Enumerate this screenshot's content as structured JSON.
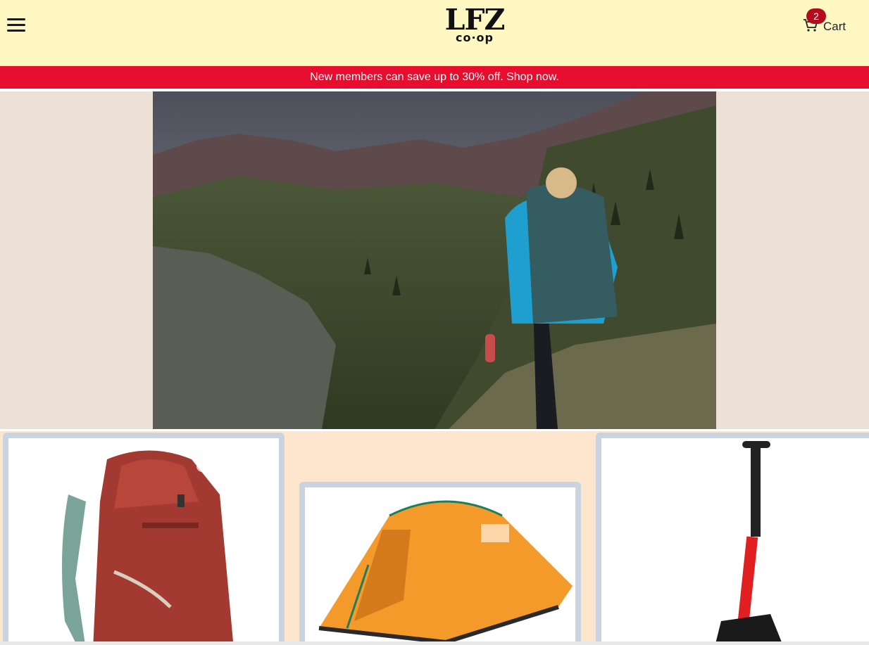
{
  "header": {
    "logo_main": "LFZ",
    "logo_sub": "co·op",
    "cart": {
      "count": "2",
      "label": "Cart",
      "icon": "cart-icon"
    },
    "menu_icon": "hamburger-menu-icon"
  },
  "promo": {
    "text": "New members can save up to 30% off. Shop now."
  },
  "colors": {
    "header_bg": "#fff8c3",
    "promo_bg": "#e60d2e",
    "hero_bg": "#ede0d7",
    "products_bg": "#fde6cd",
    "card_border": "#c9d4e0",
    "badge": "#b30c1b"
  },
  "hero": {
    "image": "hiker-mountain-photo"
  },
  "products": [
    {
      "image": "red-backpack-image"
    },
    {
      "image": "orange-tent-image"
    },
    {
      "image": "avalanche-shovel-image"
    }
  ]
}
